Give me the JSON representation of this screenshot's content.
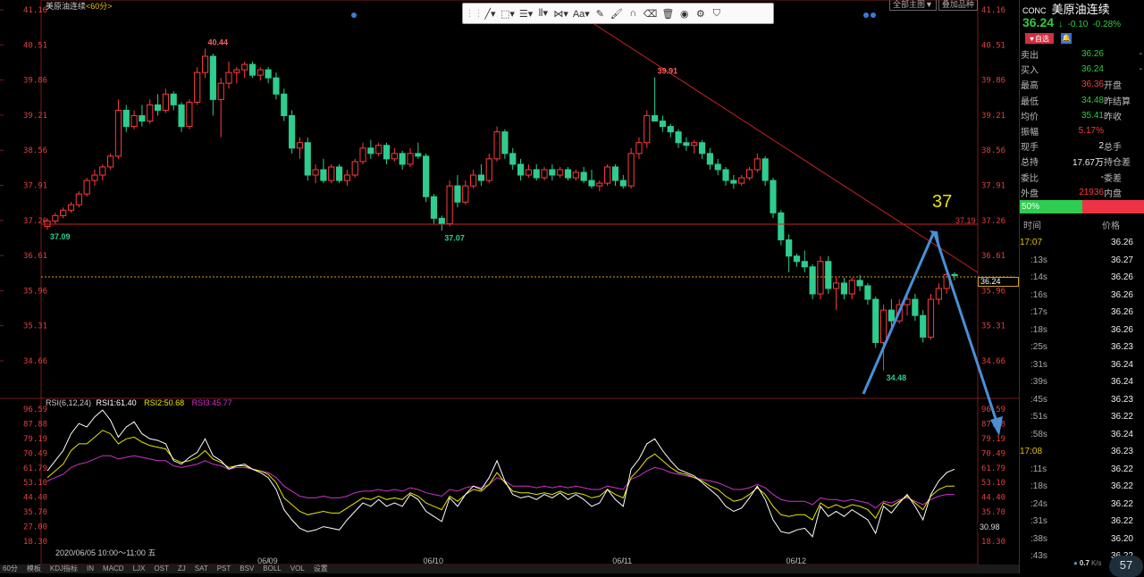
{
  "header": {
    "title": "美原油连续",
    "period": "<60分>",
    "top_button_1": "全部主图▼",
    "top_button_2": "叠加品种"
  },
  "toolbar": {
    "items": [
      {
        "name": "grip-handle",
        "glyph": "⋮⋮"
      },
      {
        "name": "line-tool",
        "glyph": "╱▾"
      },
      {
        "name": "shape-tool",
        "glyph": "⬚▾"
      },
      {
        "name": "fib-tool",
        "glyph": "☰▾"
      },
      {
        "name": "gann-tool",
        "glyph": "⦀▾"
      },
      {
        "name": "pattern-tool",
        "glyph": "⋈▾"
      },
      {
        "name": "text-tool",
        "glyph": "Aa▾"
      },
      {
        "name": "pencil-tool",
        "glyph": "✎"
      },
      {
        "name": "brush-tool",
        "glyph": "🖌"
      },
      {
        "name": "magnet-tool",
        "glyph": "∩"
      },
      {
        "name": "eraser-tool",
        "glyph": "⌫"
      },
      {
        "name": "delete-tool",
        "glyph": "🗑"
      },
      {
        "name": "eye-tool",
        "glyph": "◉"
      },
      {
        "name": "settings-tool",
        "glyph": "⚙"
      },
      {
        "name": "lock-tool",
        "glyph": "⛉"
      }
    ]
  },
  "price_axis": [
    "41.16",
    "40.51",
    "39.86",
    "39.21",
    "38.56",
    "37.91",
    "37.26",
    "36.61",
    "35.96",
    "35.31",
    "34.66"
  ],
  "rsi_axis": [
    "96.59",
    "87.88",
    "79.19",
    "70.49",
    "61.79",
    "53.10",
    "44.40",
    "35.70",
    "27.00",
    "18.30"
  ],
  "right_axis_markers": {
    "hline_label": "37.19",
    "current_price": "36.24",
    "rsi_now": "30.98"
  },
  "annotations": {
    "high_1": "40.44",
    "high_2": "39.91",
    "low_1": "37.09",
    "low_2": "37.07",
    "low_3": "34.48",
    "target": "37"
  },
  "dates": [
    "06/09",
    "06/10",
    "06/11",
    "06/12"
  ],
  "rsi_legend": {
    "name": "RSI(6,12,24)",
    "rsi1": "RSI1:61.40",
    "rsi2": "RSI2:50.68",
    "rsi3": "RSI3:45.77"
  },
  "bottom_info": "2020/06/05 10:00～11:00 五",
  "chart_data": {
    "type": "candlestick",
    "ylim": [
      34.2,
      41.16
    ],
    "rsi_ylim": [
      14,
      97
    ],
    "candles": [
      [
        37.15,
        37.3,
        37.09,
        37.25
      ],
      [
        37.25,
        37.4,
        37.2,
        37.35
      ],
      [
        37.35,
        37.5,
        37.3,
        37.45
      ],
      [
        37.45,
        37.6,
        37.4,
        37.55
      ],
      [
        37.55,
        37.8,
        37.5,
        37.75
      ],
      [
        37.75,
        38.05,
        37.7,
        38.0
      ],
      [
        38.0,
        38.2,
        37.9,
        38.1
      ],
      [
        38.1,
        38.3,
        38.0,
        38.25
      ],
      [
        38.25,
        38.5,
        38.2,
        38.45
      ],
      [
        38.45,
        39.5,
        38.4,
        39.3
      ],
      [
        39.3,
        39.4,
        38.9,
        39.0
      ],
      [
        39.0,
        39.3,
        38.95,
        39.2
      ],
      [
        39.2,
        39.4,
        39.0,
        39.1
      ],
      [
        39.1,
        39.5,
        39.05,
        39.4
      ],
      [
        39.4,
        39.6,
        39.2,
        39.3
      ],
      [
        39.3,
        39.7,
        39.25,
        39.6
      ],
      [
        39.6,
        39.65,
        39.3,
        39.4
      ],
      [
        39.4,
        39.45,
        38.9,
        39.0
      ],
      [
        39.0,
        39.5,
        38.95,
        39.45
      ],
      [
        39.45,
        40.1,
        39.4,
        40.0
      ],
      [
        40.0,
        40.44,
        39.9,
        40.3
      ],
      [
        40.3,
        40.35,
        39.2,
        39.5
      ],
      [
        39.5,
        39.9,
        38.8,
        39.8
      ],
      [
        39.8,
        40.2,
        39.7,
        40.0
      ],
      [
        40.0,
        40.1,
        39.8,
        40.05
      ],
      [
        40.05,
        40.2,
        39.9,
        40.15
      ],
      [
        40.15,
        40.2,
        39.9,
        39.95
      ],
      [
        39.95,
        40.1,
        39.85,
        40.05
      ],
      [
        40.05,
        40.1,
        39.8,
        39.9
      ],
      [
        39.9,
        40.0,
        39.5,
        39.6
      ],
      [
        39.6,
        39.7,
        39.1,
        39.2
      ],
      [
        39.2,
        39.3,
        38.5,
        38.6
      ],
      [
        38.6,
        38.8,
        38.4,
        38.7
      ],
      [
        38.7,
        38.8,
        38.0,
        38.1
      ],
      [
        38.1,
        38.3,
        37.95,
        38.2
      ],
      [
        38.2,
        38.4,
        37.95,
        38.0
      ],
      [
        38.0,
        38.3,
        37.95,
        38.25
      ],
      [
        38.25,
        38.3,
        37.95,
        38.0
      ],
      [
        38.0,
        38.2,
        37.9,
        38.1
      ],
      [
        38.1,
        38.4,
        38.05,
        38.35
      ],
      [
        38.35,
        38.7,
        38.3,
        38.6
      ],
      [
        38.6,
        38.75,
        38.4,
        38.5
      ],
      [
        38.5,
        38.7,
        38.45,
        38.65
      ],
      [
        38.65,
        38.7,
        38.3,
        38.4
      ],
      [
        38.4,
        38.6,
        38.35,
        38.5
      ],
      [
        38.5,
        38.55,
        38.2,
        38.3
      ],
      [
        38.3,
        38.6,
        38.25,
        38.5
      ],
      [
        38.5,
        38.7,
        38.4,
        38.45
      ],
      [
        38.45,
        38.5,
        37.6,
        37.7
      ],
      [
        37.7,
        37.75,
        37.2,
        37.3
      ],
      [
        37.3,
        37.35,
        37.07,
        37.2
      ],
      [
        37.2,
        38.0,
        37.15,
        37.9
      ],
      [
        37.9,
        38.1,
        37.5,
        37.6
      ],
      [
        37.6,
        38.0,
        37.55,
        37.9
      ],
      [
        37.9,
        38.2,
        37.85,
        38.1
      ],
      [
        38.1,
        38.3,
        37.9,
        38.0
      ],
      [
        38.0,
        38.5,
        37.95,
        38.4
      ],
      [
        38.4,
        39.0,
        38.35,
        38.9
      ],
      [
        38.9,
        38.95,
        38.4,
        38.5
      ],
      [
        38.5,
        38.6,
        38.2,
        38.3
      ],
      [
        38.3,
        38.4,
        38.0,
        38.1
      ],
      [
        38.1,
        38.3,
        38.05,
        38.2
      ],
      [
        38.2,
        38.3,
        38.0,
        38.05
      ],
      [
        38.05,
        38.25,
        38.0,
        38.2
      ],
      [
        38.2,
        38.3,
        38.0,
        38.1
      ],
      [
        38.1,
        38.25,
        38.05,
        38.2
      ],
      [
        38.2,
        38.25,
        38.0,
        38.05
      ],
      [
        38.05,
        38.2,
        38.0,
        38.15
      ],
      [
        38.15,
        38.25,
        37.95,
        38.0
      ],
      [
        38.0,
        38.2,
        37.85,
        37.9
      ],
      [
        37.9,
        38.0,
        37.8,
        37.95
      ],
      [
        37.95,
        38.3,
        37.9,
        38.25
      ],
      [
        38.25,
        38.3,
        37.9,
        38.0
      ],
      [
        38.0,
        38.1,
        37.85,
        37.9
      ],
      [
        37.9,
        38.6,
        37.85,
        38.5
      ],
      [
        38.5,
        38.8,
        38.4,
        38.7
      ],
      [
        38.7,
        39.3,
        38.6,
        39.2
      ],
      [
        39.2,
        39.91,
        39.1,
        39.1
      ],
      [
        39.1,
        39.2,
        38.9,
        39.0
      ],
      [
        39.0,
        39.05,
        38.8,
        38.9
      ],
      [
        38.9,
        38.95,
        38.6,
        38.7
      ],
      [
        38.7,
        38.8,
        38.55,
        38.65
      ],
      [
        38.65,
        38.75,
        38.5,
        38.7
      ],
      [
        38.7,
        38.75,
        38.4,
        38.5
      ],
      [
        38.5,
        38.6,
        38.2,
        38.3
      ],
      [
        38.3,
        38.4,
        38.1,
        38.2
      ],
      [
        38.2,
        38.25,
        37.9,
        38.0
      ],
      [
        38.0,
        38.1,
        37.85,
        37.95
      ],
      [
        37.95,
        38.1,
        37.9,
        38.05
      ],
      [
        38.05,
        38.25,
        38.0,
        38.2
      ],
      [
        38.2,
        38.5,
        38.15,
        38.4
      ],
      [
        38.4,
        38.45,
        37.9,
        38.0
      ],
      [
        38.0,
        38.05,
        37.3,
        37.4
      ],
      [
        37.4,
        37.45,
        36.8,
        36.9
      ],
      [
        36.9,
        37.0,
        36.3,
        36.6
      ],
      [
        36.6,
        36.65,
        36.4,
        36.5
      ],
      [
        36.5,
        36.7,
        36.3,
        36.4
      ],
      [
        36.4,
        36.45,
        35.8,
        35.9
      ],
      [
        35.9,
        36.6,
        35.8,
        36.5
      ],
      [
        36.5,
        36.6,
        35.9,
        36.0
      ],
      [
        36.0,
        36.2,
        35.6,
        36.1
      ],
      [
        36.1,
        36.2,
        35.8,
        35.9
      ],
      [
        35.9,
        36.2,
        35.8,
        36.15
      ],
      [
        36.15,
        36.25,
        35.95,
        36.05
      ],
      [
        36.05,
        36.1,
        35.7,
        35.8
      ],
      [
        35.8,
        35.85,
        34.9,
        35.0
      ],
      [
        35.0,
        35.7,
        34.48,
        35.6
      ],
      [
        35.6,
        35.8,
        35.2,
        35.4
      ],
      [
        35.4,
        35.8,
        35.35,
        35.7
      ],
      [
        35.7,
        35.9,
        35.5,
        35.8
      ],
      [
        35.8,
        35.9,
        35.4,
        35.5
      ],
      [
        35.5,
        35.6,
        35.0,
        35.1
      ],
      [
        35.1,
        35.9,
        35.05,
        35.8
      ],
      [
        35.8,
        36.1,
        35.7,
        36.0
      ],
      [
        36.0,
        36.3,
        35.9,
        36.26
      ],
      [
        36.26,
        36.3,
        36.15,
        36.24
      ]
    ],
    "rsi1": [
      60,
      66,
      72,
      82,
      88,
      86,
      92,
      96,
      90,
      80,
      86,
      89,
      82,
      79,
      78,
      76,
      66,
      64,
      68,
      71,
      79,
      69,
      66,
      61,
      63,
      64,
      61,
      59,
      56,
      49,
      37,
      31,
      26,
      24,
      25,
      27,
      26,
      25,
      31,
      36,
      41,
      39,
      43,
      39,
      41,
      39,
      46,
      43,
      36,
      33,
      30,
      44,
      39,
      46,
      51,
      49,
      56,
      66,
      54,
      46,
      44,
      45,
      43,
      46,
      44,
      47,
      43,
      46,
      43,
      39,
      41,
      49,
      43,
      39,
      61,
      67,
      76,
      79,
      72,
      66,
      61,
      59,
      57,
      53,
      49,
      45,
      39,
      36,
      38,
      44,
      51,
      43,
      31,
      24,
      23,
      25,
      26,
      21,
      39,
      33,
      36,
      33,
      37,
      34,
      31,
      23,
      39,
      35,
      41,
      46,
      39,
      31,
      46,
      54,
      59,
      61
    ],
    "rsi2": [
      56,
      60,
      64,
      72,
      76,
      76,
      80,
      84,
      82,
      76,
      79,
      80,
      77,
      75,
      74,
      73,
      67,
      65,
      66,
      68,
      72,
      67,
      65,
      62,
      63,
      63,
      61,
      60,
      58,
      53,
      44,
      40,
      36,
      34,
      35,
      36,
      35,
      35,
      38,
      41,
      44,
      43,
      45,
      43,
      44,
      43,
      47,
      45,
      41,
      39,
      37,
      45,
      42,
      46,
      49,
      48,
      52,
      59,
      53,
      48,
      47,
      47,
      46,
      47,
      46,
      48,
      46,
      47,
      46,
      44,
      45,
      49,
      46,
      44,
      56,
      61,
      67,
      70,
      66,
      62,
      59,
      58,
      56,
      54,
      51,
      49,
      45,
      42,
      43,
      46,
      50,
      46,
      39,
      34,
      33,
      34,
      34,
      31,
      41,
      38,
      40,
      38,
      40,
      39,
      37,
      32,
      41,
      39,
      42,
      45,
      41,
      37,
      45,
      49,
      51,
      51
    ],
    "rsi3": [
      54,
      56,
      58,
      62,
      64,
      65,
      67,
      69,
      69,
      67,
      68,
      69,
      68,
      67,
      66,
      66,
      63,
      62,
      63,
      64,
      66,
      64,
      63,
      61,
      62,
      62,
      61,
      60,
      59,
      56,
      51,
      48,
      45,
      44,
      44,
      45,
      44,
      44,
      45,
      47,
      48,
      48,
      49,
      48,
      49,
      48,
      50,
      49,
      47,
      46,
      45,
      49,
      48,
      50,
      51,
      50,
      52,
      56,
      54,
      51,
      51,
      51,
      50,
      51,
      50,
      51,
      50,
      51,
      50,
      49,
      49,
      51,
      50,
      49,
      55,
      57,
      60,
      62,
      61,
      59,
      58,
      57,
      56,
      55,
      54,
      53,
      51,
      49,
      49,
      50,
      52,
      50,
      46,
      43,
      42,
      42,
      42,
      40,
      44,
      43,
      43,
      42,
      43,
      42,
      41,
      38,
      42,
      41,
      43,
      44,
      42,
      40,
      43,
      45,
      46,
      46
    ]
  },
  "right_panel": {
    "code": "CONC",
    "name": "美原油连续",
    "price": "36.24",
    "arrow": "↓",
    "change": "-0.10",
    "change_pct": "-0.28%",
    "btn_watch": "自选",
    "rows": [
      {
        "label": "卖出",
        "value": "36.26",
        "color": "green",
        "label2": "",
        "value2": "-"
      },
      {
        "label": "买入",
        "value": "36.24",
        "color": "green",
        "label2": "",
        "value2": "-"
      },
      {
        "label": "最高",
        "value": "36.36",
        "color": "red",
        "label2": "开盘",
        "value2": ""
      },
      {
        "label": "最低",
        "value": "34.48",
        "color": "green",
        "label2": "昨结算",
        "value2": ""
      },
      {
        "label": "均价",
        "value": "35.41",
        "color": "green",
        "label2": "昨收",
        "value2": ""
      },
      {
        "label": "振幅",
        "value": "5.17%",
        "color": "red",
        "label2": "",
        "value2": ""
      },
      {
        "label": "现手",
        "value": "2",
        "color": "white",
        "label2": "总手",
        "value2": ""
      },
      {
        "label": "总持",
        "value": "17.67万",
        "color": "white",
        "label2": "持仓差",
        "value2": ""
      },
      {
        "label": "委比",
        "value": "-",
        "color": "white",
        "label2": "委差",
        "value2": ""
      },
      {
        "label": "外盘",
        "value": "21936",
        "color": "red",
        "label2": "内盘",
        "value2": ""
      }
    ],
    "ratio_label": "50%",
    "tick_header_time": "时间",
    "tick_header_price": "价格",
    "ticks": [
      {
        "time": "17:07",
        "price": "36.26",
        "color": "white",
        "yellow": true
      },
      {
        "time": ":13s",
        "price": "36.27",
        "color": "white",
        "yellow": false
      },
      {
        "time": ":14s",
        "price": "36.26",
        "color": "white",
        "yellow": false
      },
      {
        "time": ":16s",
        "price": "36.26",
        "color": "white",
        "yellow": false
      },
      {
        "time": ":17s",
        "price": "36.26",
        "color": "white",
        "yellow": false
      },
      {
        "time": ":18s",
        "price": "36.26",
        "color": "white",
        "yellow": false
      },
      {
        "time": ":25s",
        "price": "36.23",
        "color": "white",
        "yellow": false
      },
      {
        "time": ":31s",
        "price": "36.24",
        "color": "white",
        "yellow": false
      },
      {
        "time": ":39s",
        "price": "36.24",
        "color": "white",
        "yellow": false
      },
      {
        "time": ":45s",
        "price": "36.23",
        "color": "white",
        "yellow": false
      },
      {
        "time": ":51s",
        "price": "36.22",
        "color": "white",
        "yellow": false
      },
      {
        "time": ":58s",
        "price": "36.24",
        "color": "white",
        "yellow": false
      },
      {
        "time": "17:08",
        "price": "36.23",
        "color": "white",
        "yellow": true
      },
      {
        "time": ":11s",
        "price": "36.22",
        "color": "white",
        "yellow": false
      },
      {
        "time": ":18s",
        "price": "36.22",
        "color": "white",
        "yellow": false
      },
      {
        "time": ":24s",
        "price": "36.22",
        "color": "white",
        "yellow": false
      },
      {
        "time": ":31s",
        "price": "36.22",
        "color": "white",
        "yellow": false
      },
      {
        "time": ":38s",
        "price": "36.20",
        "color": "white",
        "yellow": false
      },
      {
        "time": ":43s",
        "price": "36.22",
        "color": "white",
        "yellow": false
      }
    ],
    "net_speed": "0.7",
    "net_unit": "K/s",
    "net_badge": "57"
  },
  "bottom_tabs": [
    "60分",
    "模板",
    "KDJ指标",
    "IN",
    "MACD",
    "LJX",
    "OST",
    "ZJ",
    "SAT",
    "PST",
    "BSV",
    "BOLL",
    "VOL",
    "设置"
  ],
  "colors": {
    "up": "#ff3b3b",
    "down": "#2ecc8f",
    "axis": "#e04040",
    "rsi1": "#ffffff",
    "rsi2": "#e6e600",
    "rsi3": "#cc33cc",
    "arrow": "#4a8fd6"
  }
}
